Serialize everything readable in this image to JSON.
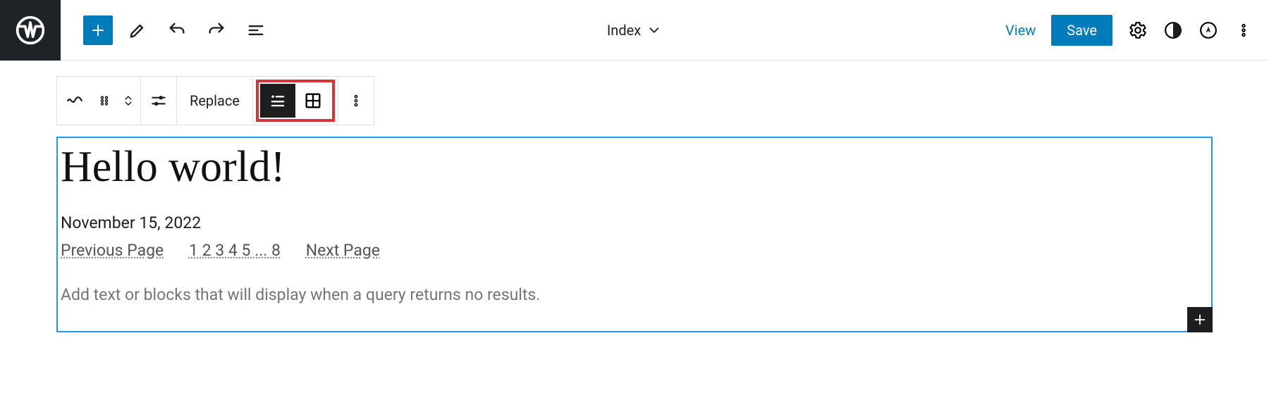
{
  "header": {
    "template_name": "Index",
    "view_label": "View",
    "save_label": "Save"
  },
  "block_toolbar": {
    "replace_label": "Replace"
  },
  "canvas": {
    "post_title": "Hello world!",
    "post_date": "November 15, 2022",
    "pagination": {
      "prev": "Previous Page",
      "pages": "1 2 3 4 5 ... 8",
      "next": "Next Page"
    },
    "no_results_placeholder": "Add text or blocks that will display when a query returns no results."
  }
}
